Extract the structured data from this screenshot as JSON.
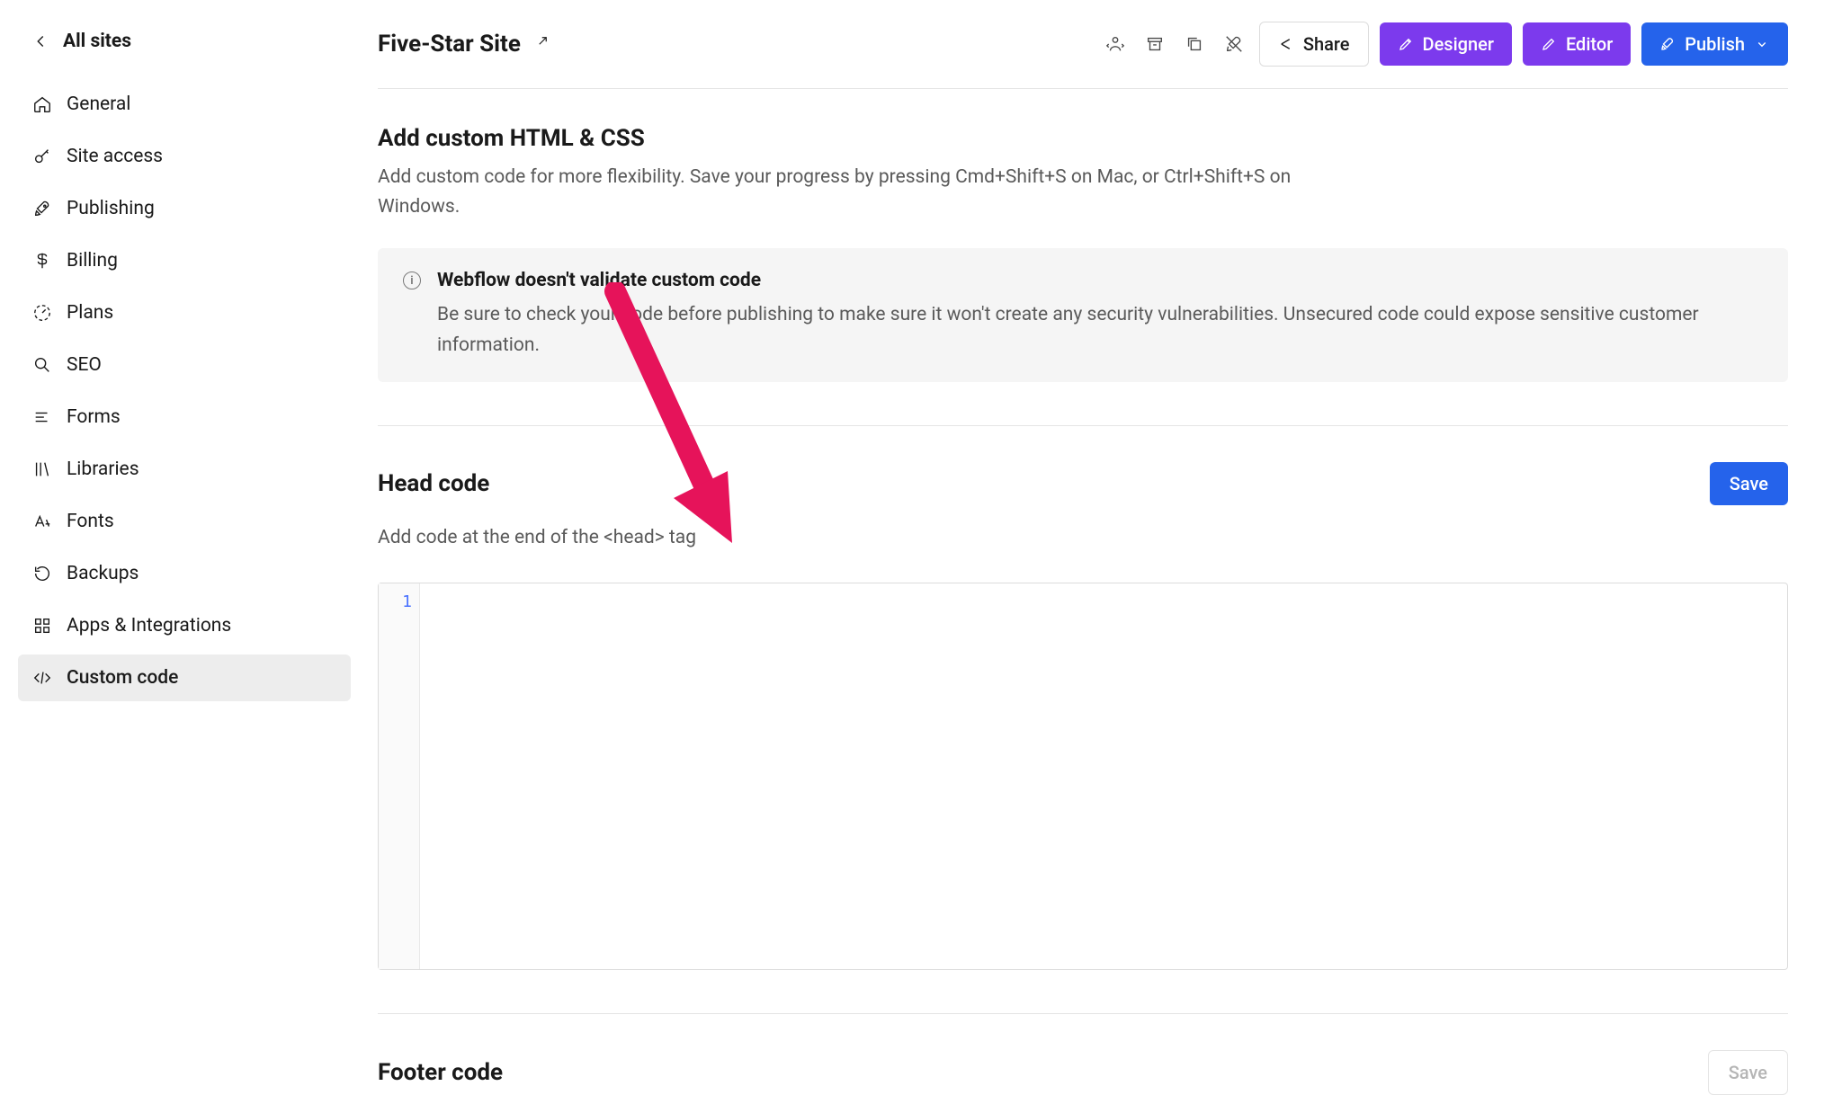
{
  "sidebar": {
    "back_label": "All sites",
    "items": [
      {
        "label": "General"
      },
      {
        "label": "Site access"
      },
      {
        "label": "Publishing"
      },
      {
        "label": "Billing"
      },
      {
        "label": "Plans"
      },
      {
        "label": "SEO"
      },
      {
        "label": "Forms"
      },
      {
        "label": "Libraries"
      },
      {
        "label": "Fonts"
      },
      {
        "label": "Backups"
      },
      {
        "label": "Apps & Integrations"
      },
      {
        "label": "Custom code"
      }
    ]
  },
  "header": {
    "site_name": "Five-Star Site",
    "share_label": "Share",
    "designer_label": "Designer",
    "editor_label": "Editor",
    "publish_label": "Publish"
  },
  "main": {
    "title": "Add custom HTML & CSS",
    "description": "Add custom code for more flexibility. Save your progress by pressing Cmd+Shift+S on Mac, or Ctrl+Shift+S on Windows.",
    "info_title": "Webflow doesn't validate custom code",
    "info_body": "Be sure to check your code before publishing to make sure it won't create any security vulnerabilities. Unsecured code could expose sensitive customer information."
  },
  "head": {
    "title": "Head code",
    "save_label": "Save",
    "description": "Add code at the end of the <head> tag",
    "line_number": "1"
  },
  "footer": {
    "title": "Footer code",
    "save_label": "Save"
  }
}
